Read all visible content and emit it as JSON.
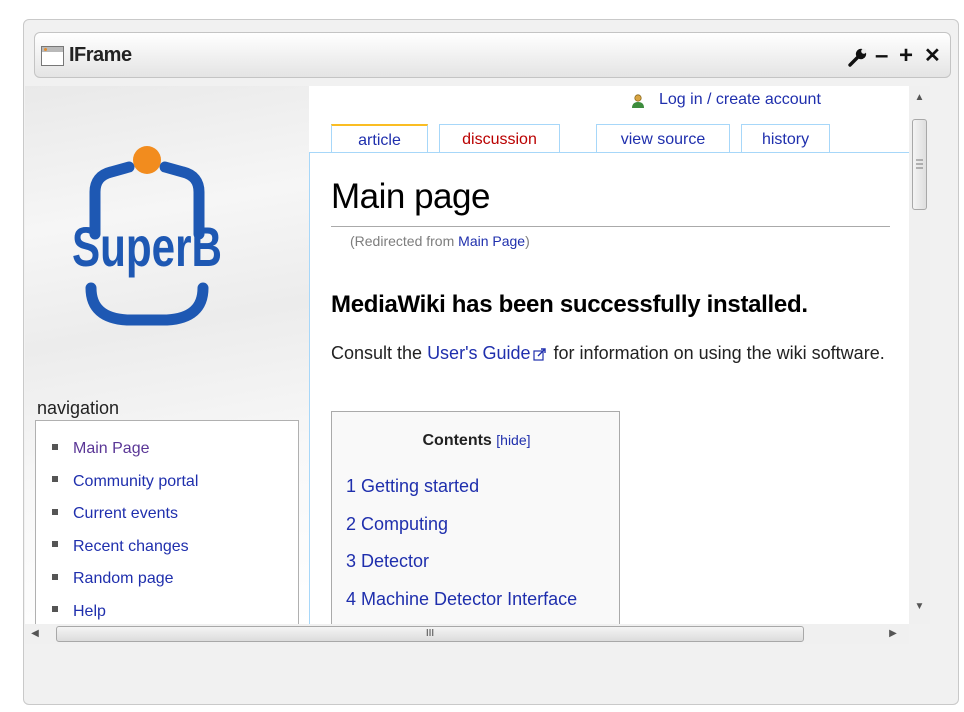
{
  "window": {
    "title": "IFrame",
    "icon": "window-icon",
    "buttons": {
      "settings": "wrench-icon",
      "minimize_glyph": "–",
      "maximize_glyph": "+",
      "close_glyph": "✕"
    }
  },
  "site": {
    "logo_text": "SuperB",
    "colors": {
      "logo_blue": "#1e58b3",
      "logo_orange": "#f28c1e",
      "link": "#1f2fad",
      "visited": "#5a3696",
      "tab_border": "#a7d7f9"
    }
  },
  "personal": {
    "login_label": "Log in / create account",
    "icon": "user-icon"
  },
  "tabs": [
    {
      "label": "article",
      "selected": true
    },
    {
      "label": "discussion",
      "selected": false
    },
    {
      "label": "view source",
      "selected": false
    },
    {
      "label": "history",
      "selected": false
    }
  ],
  "page": {
    "title": "Main page",
    "redirect_prefix": "(Redirected from ",
    "redirect_link": "Main Page",
    "redirect_suffix": ")",
    "heading": "MediaWiki has been successfully installed.",
    "para_before": "Consult the ",
    "para_link": "User's Guide",
    "para_after": " for information on using the wiki software."
  },
  "toc": {
    "title": "Contents",
    "hide_label": "[hide]",
    "items": [
      "1 Getting started",
      "2 Computing",
      "3 Detector",
      "4 Machine Detector Interface"
    ]
  },
  "navigation": {
    "heading": "navigation",
    "items": [
      "Main Page",
      "Community portal",
      "Current events",
      "Recent changes",
      "Random page",
      "Help"
    ]
  },
  "scrollbars": {
    "hthumb_grip": "III"
  }
}
